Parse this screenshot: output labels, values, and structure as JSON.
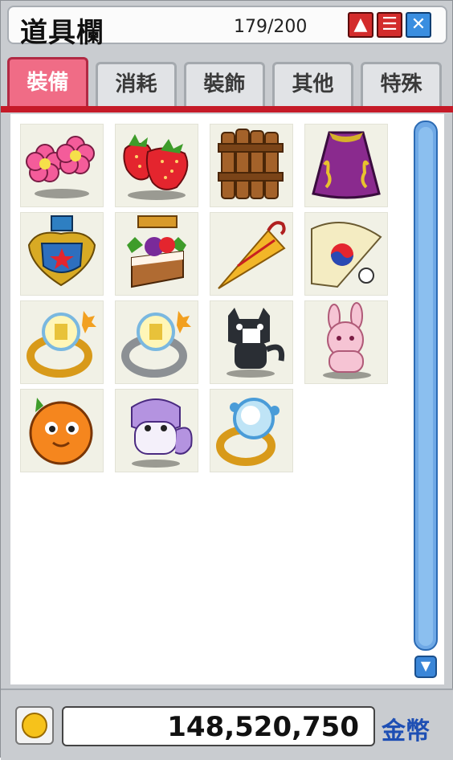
{
  "window": {
    "title": "道具欄",
    "count": "179/200"
  },
  "titlebar_buttons": [
    {
      "icon": "arrow-up-icon",
      "glyph": "▲"
    },
    {
      "icon": "menu-icon",
      "glyph": "☰"
    },
    {
      "icon": "expand-icon",
      "glyph": "✕"
    }
  ],
  "tabs": [
    {
      "label": "裝備",
      "active": true
    },
    {
      "label": "消耗",
      "active": false
    },
    {
      "label": "裝飾",
      "active": false
    },
    {
      "label": "其他",
      "active": false
    },
    {
      "label": "特殊",
      "active": false
    }
  ],
  "items": [
    {
      "icon": "flower-icon"
    },
    {
      "icon": "strawberry-icon"
    },
    {
      "icon": "wooden-gate-icon"
    },
    {
      "icon": "purple-cape-icon"
    },
    {
      "icon": "medal-emblem-icon"
    },
    {
      "icon": "cake-icon"
    },
    {
      "icon": "umbrella-icon"
    },
    {
      "icon": "fan-icon"
    },
    {
      "icon": "gold-ring-icon"
    },
    {
      "icon": "silver-ring-icon"
    },
    {
      "icon": "black-cat-icon"
    },
    {
      "icon": "pink-rabbit-icon"
    },
    {
      "icon": "orange-pet-icon"
    },
    {
      "icon": "purple-pet-icon"
    },
    {
      "icon": "crystal-ring-icon"
    }
  ],
  "bottom": {
    "coin_icon": "coin-icon",
    "money": "148,520,750",
    "currency": "金幣"
  },
  "colors": {
    "active_tab": "#f06c86",
    "accent_red": "#c51a28",
    "scroll_blue": "#6fa9e6",
    "currency_blue": "#1e4fb4"
  }
}
